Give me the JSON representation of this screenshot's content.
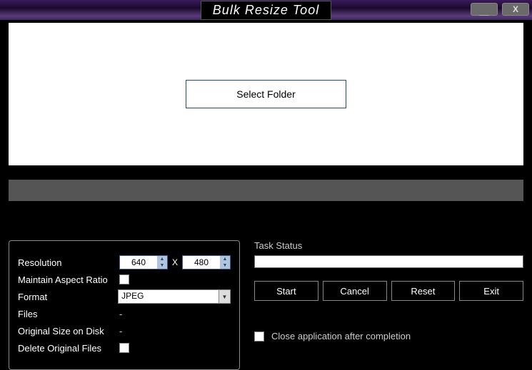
{
  "title": "Bulk Resize Tool",
  "folder": {
    "select_button": "Select Folder"
  },
  "settings": {
    "resolution_label": "Resolution",
    "width_value": "640",
    "height_value": "480",
    "x_symbol": "X",
    "aspect_label": "Maintain Aspect Ratio",
    "format_label": "Format",
    "format_value": "JPEG",
    "files_label": "Files",
    "files_value": "-",
    "size_label": "Original Size on Disk",
    "size_value": "-",
    "delete_label": "Delete Original Files"
  },
  "task": {
    "status_label": "Task Status",
    "start": "Start",
    "cancel": "Cancel",
    "reset": "Reset",
    "exit": "Exit",
    "close_after": "Close application after completion"
  }
}
